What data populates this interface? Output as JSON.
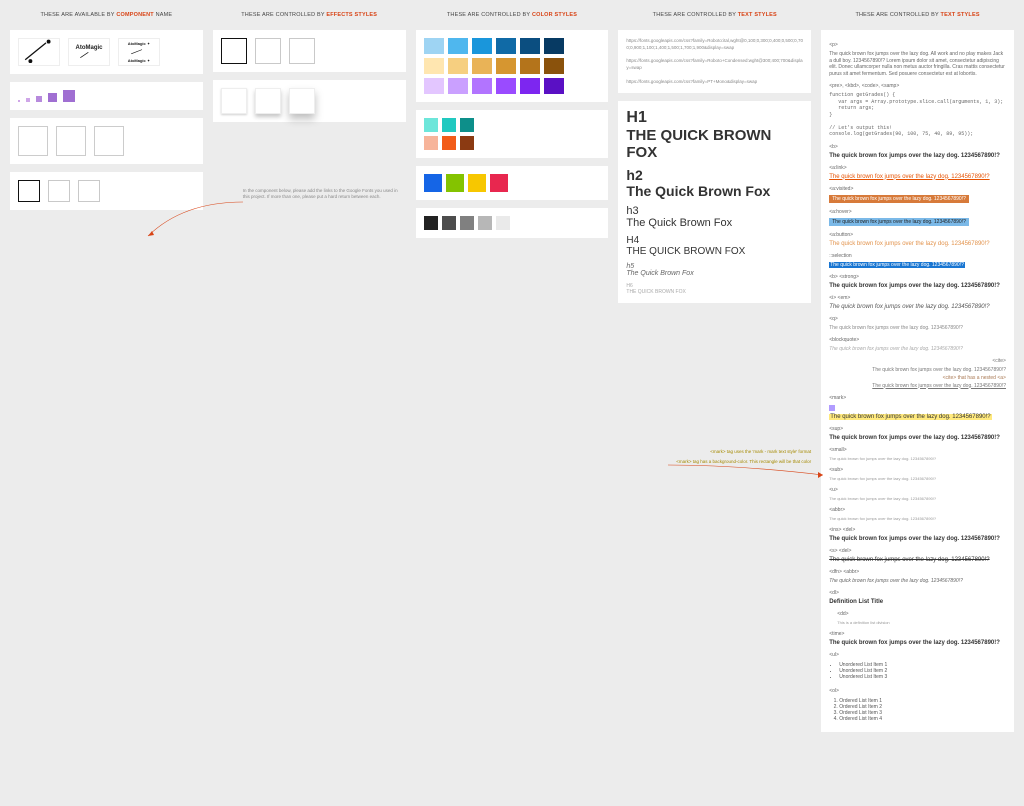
{
  "headers": {
    "c1_a": "THESE ARE AVAILABLE BY",
    "c1_b": "COMPONENT",
    "c1_c": "NAME",
    "c2_a": "THESE ARE CONTROLLED BY",
    "c2_b": "EFFECTS STYLES",
    "c3_a": "THESE ARE CONTROLLED BY",
    "c3_b": "COLOR STYLES",
    "c4_a": "THESE ARE CONTROLLED BY",
    "c4_b": "TEXT STYLES",
    "c5_a": "THESE ARE CONTROLLED BY",
    "c5_b": "TEXT STYLES"
  },
  "logos": {
    "brand": "AtoMagic"
  },
  "note_fonts": "In the component below, please add the links to the Google Fonts you used in this project. If more than one, please put a hard return between each.",
  "fontlinks": [
    "https://fonts.googleapis.com/css?family=Roboto:ital,wght@0,100;0,300;0,400;0,500;0,700;0,900;1,100;1,400;1,500;1,700;1,900&display=swap",
    "https://fonts.googleapis.com/css?family=Roboto+Condensed:wght@300;400;700&display=swap",
    "https://fonts.googleapis.com/css?family=PT+Mono&display=swap"
  ],
  "palettes": {
    "blues": [
      "#9ed4f3",
      "#4fb7ee",
      "#1a96db",
      "#106aa6",
      "#0b4e80",
      "#073a63"
    ],
    "golds": [
      "#ffe6b0",
      "#f6cf80",
      "#e9b357",
      "#d69630",
      "#b4741b",
      "#8a520c"
    ],
    "purples": [
      "#e3c6ff",
      "#caa0ff",
      "#b274ff",
      "#9a4bff",
      "#7d26f0",
      "#5a10c4"
    ],
    "teals": [
      "#6de6da",
      "#21c9c0",
      "#0d8f8a"
    ],
    "oranges": [
      "#f7b49a",
      "#f25c19",
      "#8b3a12"
    ],
    "primary": [
      "#1565e6",
      "#84c300",
      "#f7c700",
      "#e8274f"
    ],
    "grays": [
      "#222222",
      "#4d4d4d",
      "#808080",
      "#b7b7b7",
      "#eaeaea"
    ],
    "dots": [
      "#cfa6e8",
      "#b78add",
      "#a06fd2"
    ]
  },
  "typo": {
    "h1": "H1",
    "h1b": "THE QUICK BROWN FOX",
    "h2": "h2",
    "h2b": "The Quick Brown Fox",
    "h3": "h3",
    "h3b": "The Quick Brown Fox",
    "h4": "H4",
    "h4b": "THE QUICK BROWN FOX",
    "h5": "h5",
    "h5b": "The Quick Brown Fox",
    "h6": "H6",
    "h6b": "THE QUICK BROWN FOX"
  },
  "samples": {
    "p_tag": "<p>",
    "p_text": "The quick brown fox jumps over the lazy dog. All work and no play makes Jack a dull boy. 1234567890!? Lorem ipsum dolor sit amet, consectetur adipiscing elit. Donec ullamcorper nulla non metus auctor fringilla. Cras mattis consectetur purus sit amet fermentum. Sed posuere consectetur est at lobortis.",
    "pre_tag": "<pre>, <kbd>, <code>, <samp>",
    "pre_text": "function getGrades() {\n   var args = Array.prototype.slice.call(arguments, 1, 3);\n   return args;\n}\n\n// Let's output this!\nconsole.log(getGrades(90, 100, 75, 40, 89, 95));",
    "b_tag": "<b>",
    "sample_text": "The quick brown fox jumps over the lazy dog. 1234567890!?",
    "alink_tag": "<a:link>",
    "avisited_tag": "<a:visited>",
    "ahover_tag": "<a:hover>",
    "abutton_tag": "<a:button>",
    "sel_tag": "::selection",
    "strong_tag": "<b> <strong>",
    "em_tag": "<i> <em>",
    "q_tag": "<q>",
    "bq_tag": "<blockquote>",
    "cite_tag": "<cite>",
    "cite_text": "<cite> that has a nested <a>",
    "mark_tag": "<mark> ",
    "sup_tag": "<sup>",
    "small_tag": "<small>",
    "sub_tag": "<sub>",
    "u_tag": "<u>",
    "abbr_tag": "<abbr>",
    "del_tag": "<ins> <del>",
    "del2_tag": "<s> <del>",
    "dfn_tag": "<dfn> <abbr>",
    "dl_tag": "<dl>",
    "dl_title": "Definition List Title",
    "dd_tag": "<dd>",
    "dd_text": "This is a definition list division",
    "time_tag": "<time>",
    "ul_tag": "<ul>",
    "ul_items": [
      "Unordered List Item 1",
      "Unordered List Item 2",
      "Unordered List Item 3"
    ],
    "ol_tag": "<ol>",
    "ol_items": [
      "Ordered List Item 1",
      "Ordered List Item 2",
      "Ordered List Item 3",
      "Ordered List Item 4"
    ]
  },
  "annot": {
    "mark1": "<mark> tag uses the 'mark - mark text style' format",
    "mark2": "<mark> tag has a background-color. This rectangle will be that color"
  }
}
